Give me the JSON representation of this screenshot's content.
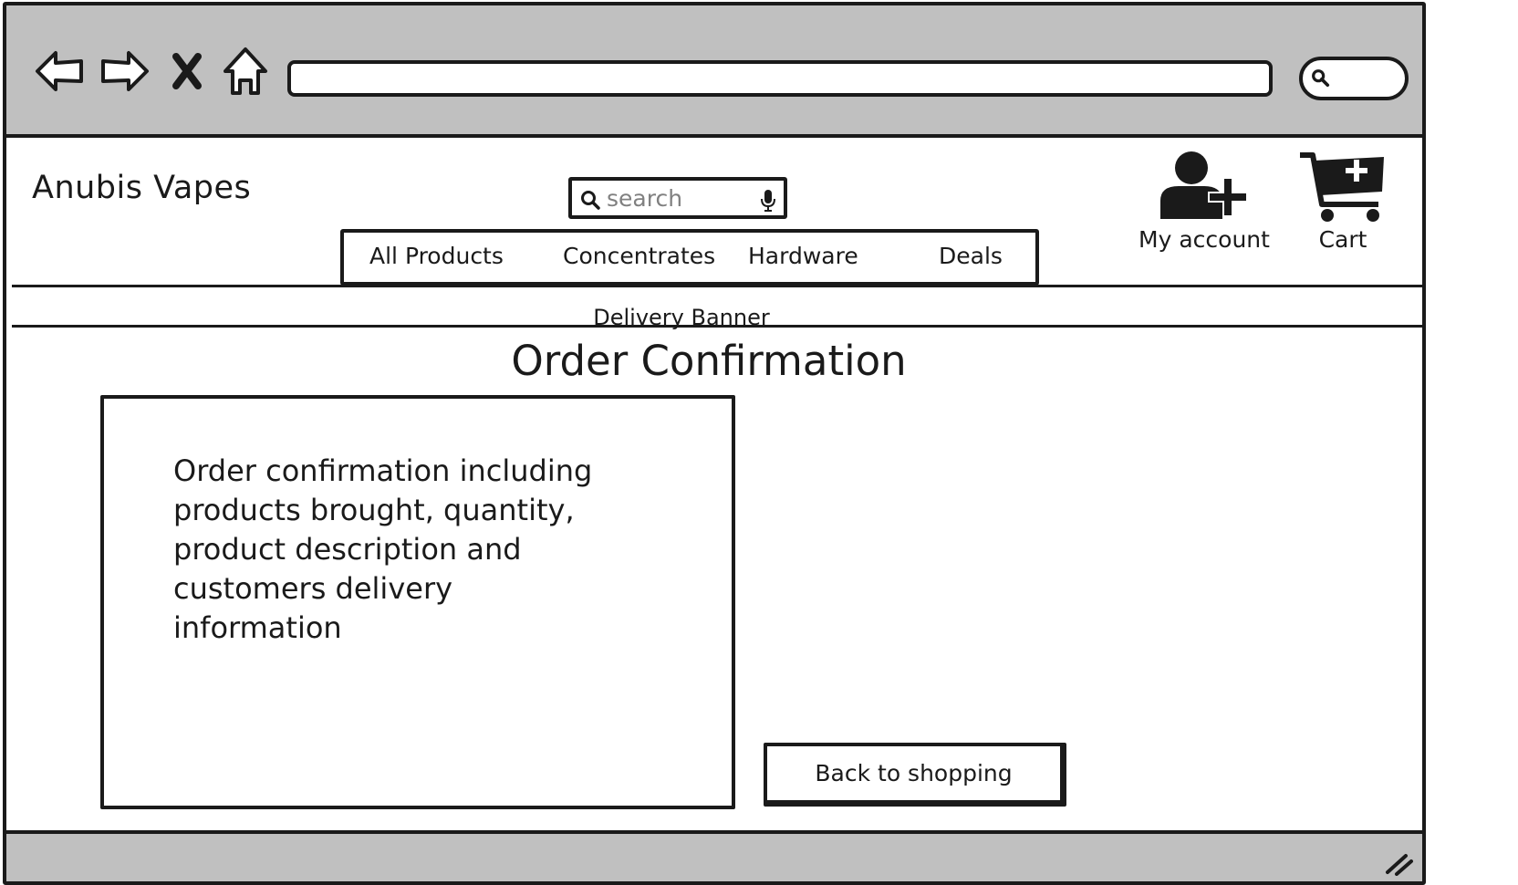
{
  "browser": {
    "url": "",
    "search": ""
  },
  "header": {
    "logo": "Anubis Vapes",
    "search_placeholder": "search",
    "nav": [
      {
        "label": "All Products"
      },
      {
        "label": "Concentrates"
      },
      {
        "label": "Hardware"
      },
      {
        "label": "Deals"
      }
    ],
    "account_label": "My account",
    "cart_label": "Cart"
  },
  "banner": {
    "text": "Delivery Banner"
  },
  "main": {
    "title": "Order Confirmation",
    "info_text": "Order confirmation including products brought, quantity, product description and customers delivery information",
    "back_button_label": "Back to shopping"
  }
}
